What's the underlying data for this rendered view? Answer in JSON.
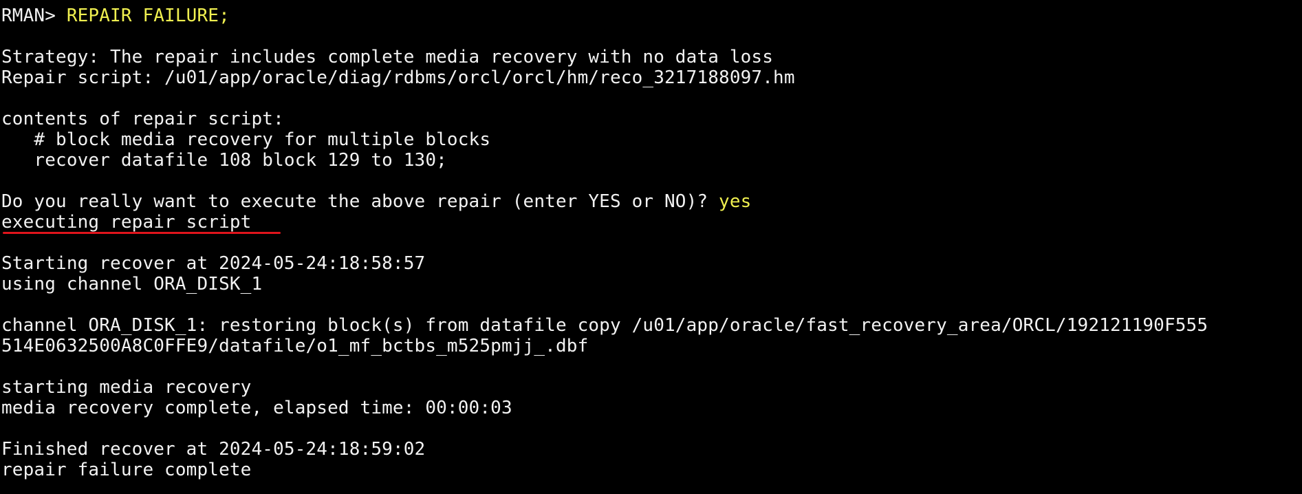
{
  "terminal": {
    "prompt": "RMAN> ",
    "command": "REPAIR FAILURE;",
    "strategy": "Strategy: The repair includes complete media recovery with no data loss",
    "repair_script": "Repair script: /u01/app/oracle/diag/rdbms/orcl/orcl/hm/reco_3217188097.hm",
    "contents_header": "contents of repair script:",
    "script_comment": "   # block media recovery for multiple blocks",
    "script_command": "   recover datafile 108 block 129 to 130;",
    "confirm_question": "Do you really want to execute the above repair (enter YES or NO)? ",
    "confirm_answer": "yes",
    "executing": "executing repair script",
    "starting_recover": "Starting recover at 2024-05-24:18:58:57",
    "using_channel": "using channel ORA_DISK_1",
    "channel_restore_1": "channel ORA_DISK_1: restoring block(s) from datafile copy /u01/app/oracle/fast_recovery_area/ORCL/192121190F555",
    "channel_restore_2": "514E0632500A8C0FFE9/datafile/o1_mf_bctbs_m525pmjj_.dbf",
    "starting_media": "starting media recovery",
    "media_complete": "media recovery complete, elapsed time: 00:00:03",
    "finished_recover": "Finished recover at 2024-05-24:18:59:02",
    "repair_complete": "repair failure complete"
  },
  "colors": {
    "background": "#000000",
    "text": "#f2f2f2",
    "input": "#f0f050",
    "annotation": "#e0141c"
  }
}
